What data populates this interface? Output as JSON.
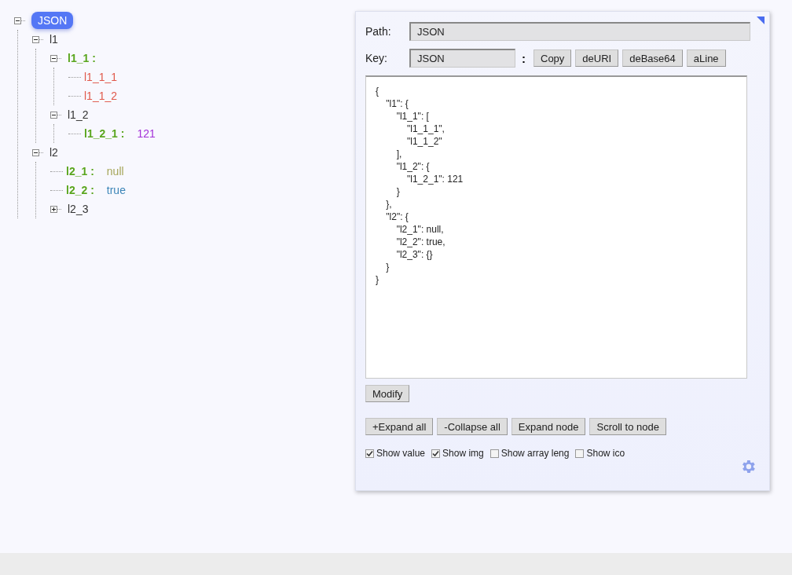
{
  "tree": {
    "key": "JSON",
    "kind": "root",
    "selected": true,
    "expanded": true,
    "children": [
      {
        "key": "l1",
        "kind": "object",
        "selected": false,
        "expanded": true,
        "children": [
          {
            "key": "l1_1",
            "kind": "array",
            "separator": ":",
            "selected": false,
            "expanded": true,
            "children": [
              {
                "key": "l1_1_1",
                "kind": "element",
                "selected": false
              },
              {
                "key": "l1_1_2",
                "kind": "element",
                "selected": false
              }
            ]
          },
          {
            "key": "l1_2",
            "kind": "object",
            "selected": false,
            "expanded": true,
            "children": [
              {
                "key": "l1_2_1",
                "kind": "pair",
                "separator": ":",
                "value": "121",
                "color": "#a330d8",
                "selected": false
              }
            ]
          }
        ]
      },
      {
        "key": "l2",
        "kind": "object",
        "selected": false,
        "expanded": true,
        "children": [
          {
            "key": "l2_1",
            "kind": "pair",
            "separator": ":",
            "value": "null",
            "color": "#a6a65a",
            "selected": false
          },
          {
            "key": "l2_2",
            "kind": "pair",
            "separator": ":",
            "value": "true",
            "color": "#3d86b8",
            "selected": false
          },
          {
            "key": "l2_3",
            "kind": "object",
            "selected": false,
            "expanded": false
          }
        ]
      }
    ]
  },
  "panel": {
    "path_label": "Path:",
    "path_value": "JSON",
    "key_label": "Key:",
    "key_value": "JSON",
    "separator": ":",
    "key_buttons": [
      "Copy",
      "deURI",
      "deBase64",
      "aLine"
    ],
    "json_text": "{\n    \"l1\": {\n        \"l1_1\": [\n            \"l1_1_1\",\n            \"l1_1_2\"\n        ],\n        \"l1_2\": {\n            \"l1_2_1\": 121\n        }\n    },\n    \"l2\": {\n        \"l2_1\": null,\n        \"l2_2\": true,\n        \"l2_3\": {}\n    }\n}",
    "modify_button": "Modify",
    "actions": [
      "+Expand all",
      "-Collapse all",
      "Expand node",
      "Scroll to node"
    ],
    "options": [
      {
        "label": "Show value",
        "checked": true
      },
      {
        "label": "Show img",
        "checked": true
      },
      {
        "label": "Show array leng",
        "checked": false
      },
      {
        "label": "Show ico",
        "checked": false
      }
    ]
  }
}
